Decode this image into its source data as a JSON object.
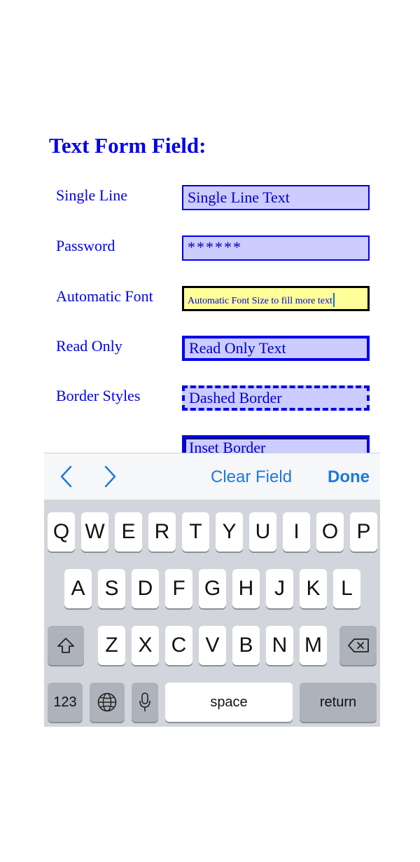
{
  "form": {
    "title": "Text Form Field:",
    "rows": [
      {
        "label": "Single Line",
        "value": "Single Line Text"
      },
      {
        "label": "Password",
        "value": "******"
      },
      {
        "label": "Automatic Font",
        "value": "Automatic Font Size to fill more text"
      },
      {
        "label": "Read Only",
        "value": "Read Only Text"
      },
      {
        "label": "Border Styles",
        "value": "Dashed Border"
      },
      {
        "label": "",
        "value": "Inset Border"
      }
    ]
  },
  "toolbar": {
    "prev_icon": "chevron-left-icon",
    "next_icon": "chevron-right-icon",
    "clear_label": "Clear Field",
    "done_label": "Done",
    "accent_color": "#1a7ae0"
  },
  "keyboard": {
    "row1": [
      "Q",
      "W",
      "E",
      "R",
      "T",
      "Y",
      "U",
      "I",
      "O",
      "P"
    ],
    "row2": [
      "A",
      "S",
      "D",
      "F",
      "G",
      "H",
      "J",
      "K",
      "L"
    ],
    "row3": [
      "Z",
      "X",
      "C",
      "V",
      "B",
      "N",
      "M"
    ],
    "shift_icon": "shift-icon",
    "backspace_icon": "backspace-icon",
    "numbers_label": "123",
    "globe_icon": "globe-icon",
    "mic_icon": "microphone-icon",
    "space_label": "space",
    "return_label": "return"
  }
}
